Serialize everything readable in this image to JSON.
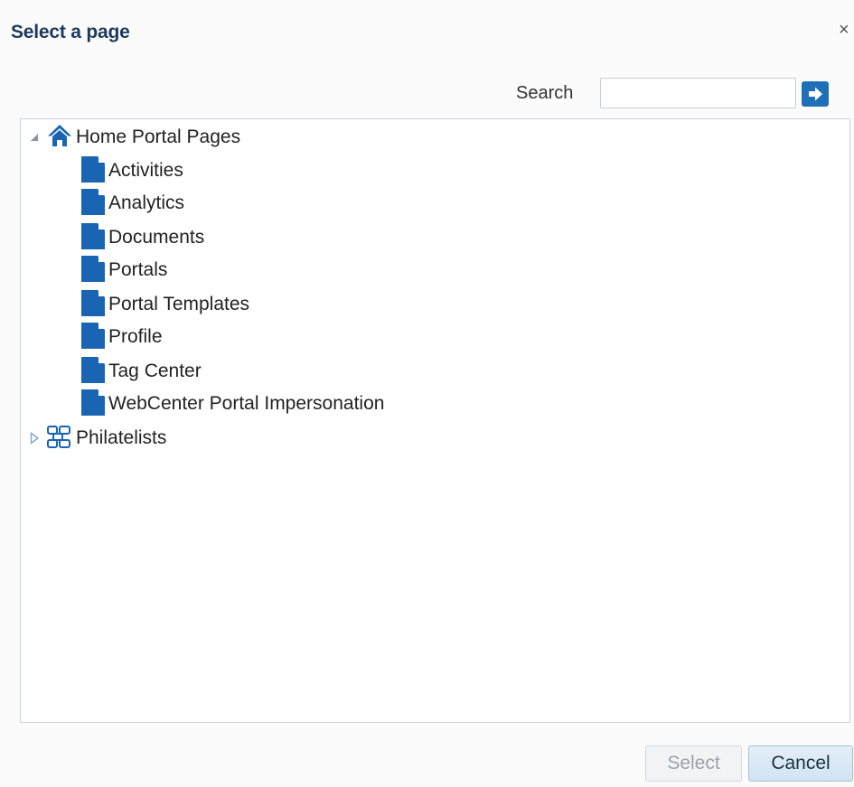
{
  "dialog": {
    "title": "Select a page",
    "close_glyph": "×",
    "close_icon": "close-icon"
  },
  "search": {
    "label": "Search",
    "value": "",
    "placeholder": "",
    "go_icon": "arrow-right-icon"
  },
  "tree": {
    "root": {
      "label": "Home Portal Pages",
      "expanded": true,
      "icon": "home-icon",
      "children": [
        {
          "label": "Activities",
          "icon": "page-icon"
        },
        {
          "label": "Analytics",
          "icon": "page-icon"
        },
        {
          "label": "Documents",
          "icon": "page-icon"
        },
        {
          "label": "Portals",
          "icon": "page-icon"
        },
        {
          "label": "Portal Templates",
          "icon": "page-icon"
        },
        {
          "label": "Profile",
          "icon": "page-icon"
        },
        {
          "label": "Tag Center",
          "icon": "page-icon"
        },
        {
          "label": "WebCenter Portal Impersonation",
          "icon": "page-icon"
        }
      ]
    },
    "second": {
      "label": "Philatelists",
      "expanded": false,
      "icon": "portal-group-icon"
    }
  },
  "buttons": {
    "select_label": "Select",
    "select_enabled": false,
    "cancel_label": "Cancel"
  },
  "colors": {
    "accent": "#1e6fb8",
    "icon_blue": "#1a64b4",
    "title": "#1d3a5c"
  }
}
